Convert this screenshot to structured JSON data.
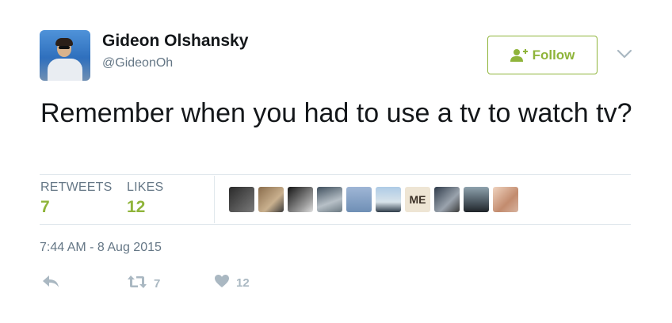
{
  "user": {
    "name": "Gideon Olshansky",
    "handle": "@GideonOh"
  },
  "follow": {
    "label": "Follow",
    "icon": "add-user-icon"
  },
  "tweet": {
    "text": "Remember when you had to use a tv to watch tv?"
  },
  "stats": {
    "retweets_label": "RETWEETS",
    "retweets_count": "7",
    "likes_label": "LIKES",
    "likes_count": "12"
  },
  "likers": [
    {
      "icon": "avatar"
    },
    {
      "icon": "avatar"
    },
    {
      "icon": "avatar"
    },
    {
      "icon": "avatar"
    },
    {
      "icon": "avatar"
    },
    {
      "icon": "avatar"
    },
    {
      "text": "ME"
    },
    {
      "icon": "avatar"
    },
    {
      "icon": "avatar"
    },
    {
      "icon": "avatar"
    }
  ],
  "timestamp": "7:44 AM - 8 Aug 2015",
  "actions": {
    "reply_icon": "reply-icon",
    "retweet_icon": "retweet-icon",
    "retweet_count": "7",
    "like_icon": "heart-icon",
    "like_count": "12"
  },
  "colors": {
    "accent_green": "#8fb43a",
    "muted": "#657786",
    "action_gray": "#aab8c2",
    "divider": "#e1e8ed"
  }
}
